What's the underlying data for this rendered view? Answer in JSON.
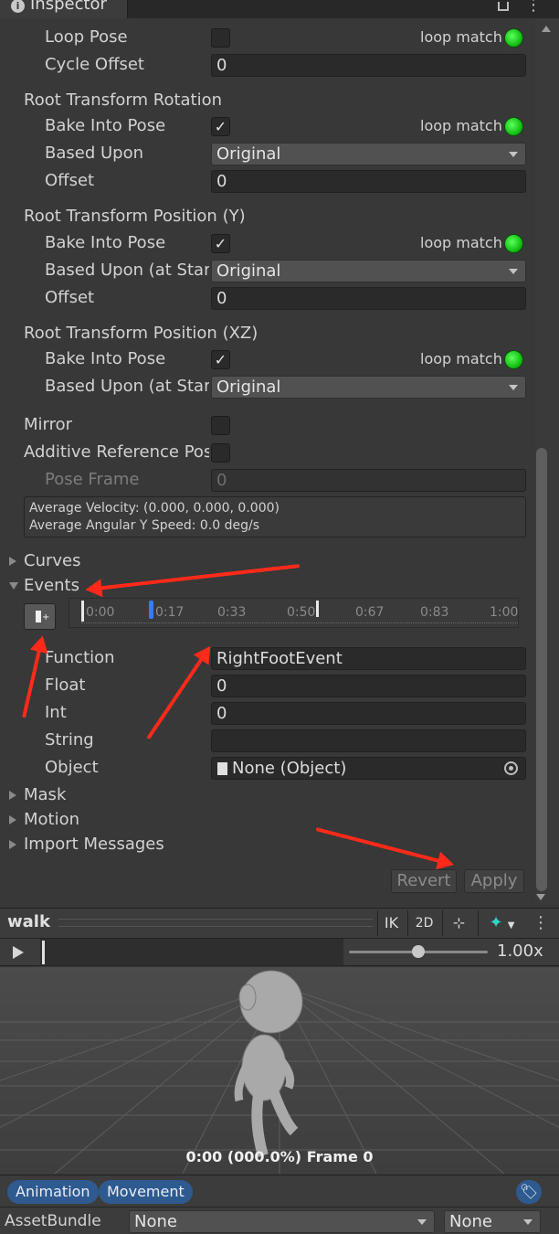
{
  "window": {
    "title": "Inspector"
  },
  "loop_pose": {
    "label": "Loop Pose",
    "match": "loop match"
  },
  "cycle_offset": {
    "label": "Cycle Offset",
    "value": "0"
  },
  "rot": {
    "header": "Root Transform Rotation",
    "bake_label": "Bake Into Pose",
    "match": "loop match",
    "based_label": "Based Upon",
    "based_value": "Original",
    "offset_label": "Offset",
    "offset_value": "0"
  },
  "posy": {
    "header": "Root Transform Position (Y)",
    "bake_label": "Bake Into Pose",
    "match": "loop match",
    "based_label": "Based Upon (at Start)",
    "based_value": "Original",
    "offset_label": "Offset",
    "offset_value": "0"
  },
  "posxz": {
    "header": "Root Transform Position (XZ)",
    "bake_label": "Bake Into Pose",
    "match": "loop match",
    "based_label": "Based Upon (at Start)",
    "based_value": "Original"
  },
  "mirror": {
    "label": "Mirror"
  },
  "additive": {
    "label": "Additive Reference Pose",
    "pose_frame_label": "Pose Frame",
    "pose_frame_value": "0"
  },
  "info": {
    "line1": "Average Velocity: (0.000, 0.000, 0.000)",
    "line2": "Average Angular Y Speed: 0.0 deg/s"
  },
  "sections": {
    "curves": "Curves",
    "events": "Events",
    "mask": "Mask",
    "motion": "Motion",
    "import_messages": "Import Messages"
  },
  "timeline": {
    "ticks": [
      "0:00",
      "0:17",
      "0:33",
      "0:50",
      "0:67",
      "0:83",
      "1:00"
    ]
  },
  "event": {
    "function_label": "Function",
    "function_value": "RightFootEvent",
    "float_label": "Float",
    "float_value": "0",
    "int_label": "Int",
    "int_value": "0",
    "string_label": "String",
    "string_value": "",
    "object_label": "Object",
    "object_value": "None (Object)"
  },
  "buttons": {
    "revert": "Revert",
    "apply": "Apply"
  },
  "preview": {
    "title": "walk",
    "ik": "IK",
    "mode2d": "2D",
    "speed": "1.00x",
    "status": "0:00 (000.0%) Frame 0",
    "speed_slider_fraction": 0.5
  },
  "labels": [
    "Animation",
    "Movement"
  ],
  "assetbundle": {
    "label": "AssetBundle",
    "name": "None",
    "variant": "None"
  },
  "colors": {
    "accent_green": "#16c016",
    "arrow_red": "#ff2a1a",
    "pill_blue": "#2e5a8f",
    "event_marker": "#3a78ff",
    "gizmo_cyan": "#2fd5c0"
  }
}
